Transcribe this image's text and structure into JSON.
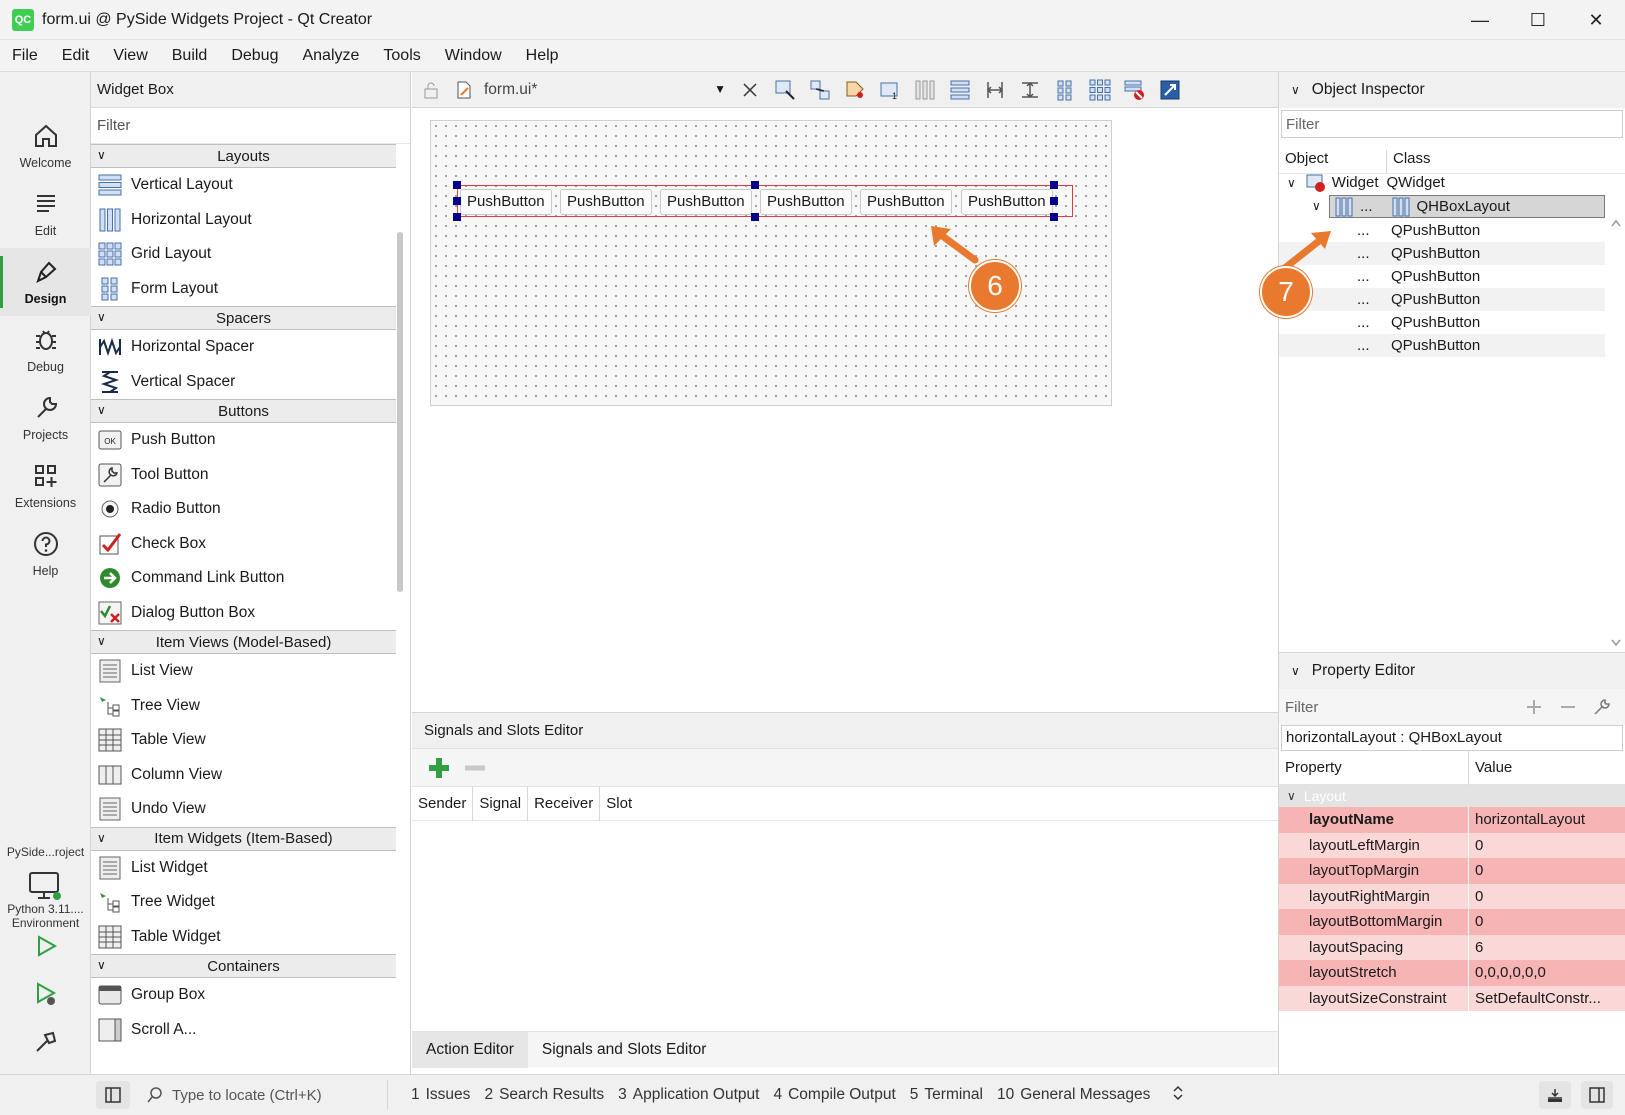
{
  "window": {
    "title": "form.ui @ PySide Widgets Project - Qt Creator",
    "app_logo": "QC",
    "controls": {
      "minimize": "—",
      "maximize": "☐",
      "close": "✕"
    }
  },
  "menu": [
    "File",
    "Edit",
    "View",
    "Build",
    "Debug",
    "Analyze",
    "Tools",
    "Window",
    "Help"
  ],
  "modes": [
    {
      "label": "Welcome",
      "icon": "home-icon"
    },
    {
      "label": "Edit",
      "icon": "document-icon"
    },
    {
      "label": "Design",
      "icon": "pen-icon",
      "active": true
    },
    {
      "label": "Debug",
      "icon": "bug-icon"
    },
    {
      "label": "Projects",
      "icon": "wrench-icon"
    },
    {
      "label": "Extensions",
      "icon": "extensions-icon"
    },
    {
      "label": "Help",
      "icon": "help-icon"
    }
  ],
  "project_selector": {
    "project": "PySide...roject",
    "env_line1": "Python 3.11....",
    "env_line2": "Environment"
  },
  "widget_box": {
    "title": "Widget Box",
    "filter_placeholder": "Filter",
    "categories": {
      "layouts": "Layouts",
      "spacers": "Spacers",
      "buttons": "Buttons",
      "item_views": "Item Views (Model-Based)",
      "item_widgets": "Item Widgets (Item-Based)",
      "containers": "Containers"
    },
    "items": {
      "vertical_layout": "Vertical Layout",
      "horizontal_layout": "Horizontal Layout",
      "grid_layout": "Grid Layout",
      "form_layout": "Form Layout",
      "horizontal_spacer": "Horizontal Spacer",
      "vertical_spacer": "Vertical Spacer",
      "push_button": "Push Button",
      "tool_button": "Tool Button",
      "radio_button": "Radio Button",
      "check_box": "Check Box",
      "command_link_button": "Command Link Button",
      "dialog_button_box": "Dialog Button Box",
      "list_view": "List View",
      "tree_view": "Tree View",
      "table_view": "Table View",
      "column_view": "Column View",
      "undo_view": "Undo View",
      "list_widget": "List Widget",
      "tree_widget": "Tree Widget",
      "table_widget": "Table Widget",
      "group_box": "Group Box",
      "scroll_area": "Scroll A..."
    }
  },
  "editor": {
    "file_name": "form.ui*",
    "push_button_text": "PushButton",
    "annotation_6": "6",
    "annotation_7": "7"
  },
  "signals_slots": {
    "title": "Signals and Slots Editor",
    "columns": [
      "Sender",
      "Signal",
      "Receiver",
      "Slot"
    ],
    "tabs": {
      "action_editor": "Action Editor",
      "signals_slots_editor": "Signals and Slots Editor"
    }
  },
  "object_inspector": {
    "title": "Object Inspector",
    "filter_placeholder": "Filter",
    "col_object": "Object",
    "col_class": "Class",
    "root": {
      "object": "Widget",
      "class": "QWidget"
    },
    "layout": {
      "object": "...",
      "class": "QHBoxLayout"
    },
    "children": [
      {
        "object": "...",
        "class": "QPushButton"
      },
      {
        "object": "...",
        "class": "QPushButton"
      },
      {
        "object": "...",
        "class": "QPushButton"
      },
      {
        "object": "...",
        "class": "QPushButton"
      },
      {
        "object": "...",
        "class": "QPushButton"
      },
      {
        "object": "...",
        "class": "QPushButton"
      }
    ]
  },
  "property_editor": {
    "title": "Property Editor",
    "filter_placeholder": "Filter",
    "object_label": "horizontalLayout : QHBoxLayout",
    "col_property": "Property",
    "col_value": "Value",
    "group": "Layout",
    "rows": [
      {
        "name": "layoutName",
        "value": "horizontalLayout"
      },
      {
        "name": "layoutLeftMargin",
        "value": "0"
      },
      {
        "name": "layoutTopMargin",
        "value": "0"
      },
      {
        "name": "layoutRightMargin",
        "value": "0"
      },
      {
        "name": "layoutBottomMargin",
        "value": "0"
      },
      {
        "name": "layoutSpacing",
        "value": "6"
      },
      {
        "name": "layoutStretch",
        "value": "0,0,0,0,0,0"
      },
      {
        "name": "layoutSizeConstraint",
        "value": "SetDefaultConstr..."
      }
    ]
  },
  "status_bar": {
    "locator_placeholder": "Type to locate (Ctrl+K)",
    "panes": [
      {
        "num": "1",
        "label": "Issues"
      },
      {
        "num": "2",
        "label": "Search Results"
      },
      {
        "num": "3",
        "label": "Application Output"
      },
      {
        "num": "4",
        "label": "Compile Output"
      },
      {
        "num": "5",
        "label": "Terminal"
      },
      {
        "num": "10",
        "label": "General Messages"
      }
    ]
  },
  "colors": {
    "accent_green": "#2ea043",
    "annotation_orange": "#e8792f",
    "layout_red": "#e03a3a",
    "handle_blue": "#00008a",
    "property_dark": "#f6b4b4",
    "property_light": "#fbd8d8"
  }
}
